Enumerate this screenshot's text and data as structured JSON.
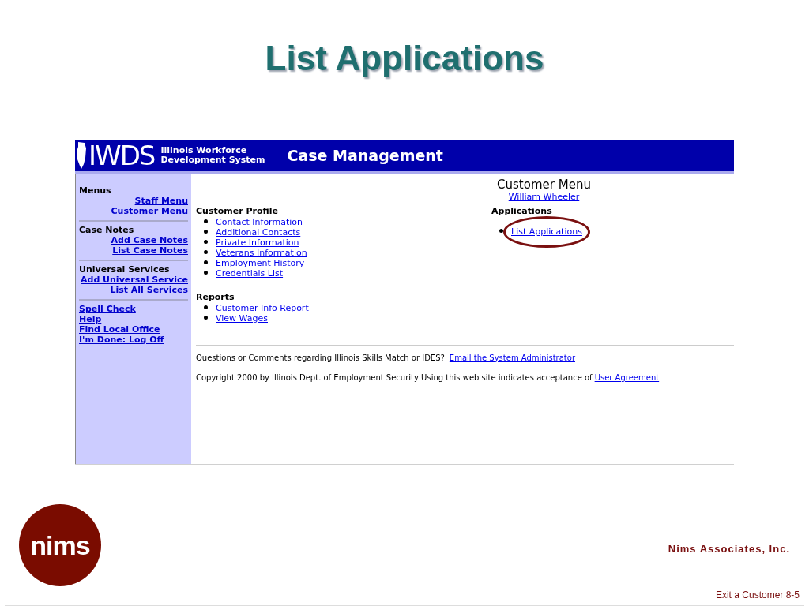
{
  "slide": {
    "title": "List Applications",
    "company": "Nims Associates, Inc.",
    "logo_text": "nims",
    "footer": "Exit a Customer 8-5"
  },
  "header": {
    "logo": "IWDS",
    "org_line1": "Illinois Workforce",
    "org_line2": "Development System",
    "title": "Case Management"
  },
  "sidebar": [
    {
      "kind": "right",
      "heading": "Menus",
      "links": [
        "Staff Menu",
        "Customer Menu"
      ]
    },
    {
      "kind": "right",
      "heading": "Case Notes",
      "links": [
        "Add Case Notes",
        "List Case Notes"
      ]
    },
    {
      "kind": "right",
      "heading": "Universal Services",
      "links": [
        "Add Universal Service",
        "List All Services"
      ]
    },
    {
      "kind": "left",
      "links": [
        "Spell Check",
        "Help",
        "Find Local Office",
        "I'm Done: Log Off"
      ]
    }
  ],
  "main": {
    "title": "Customer Menu",
    "customer": "William Wheeler",
    "customer_profile": {
      "heading": "Customer Profile",
      "items": [
        {
          "label": "Contact Information",
          "circled": false
        },
        {
          "label": "Additional Contacts",
          "circled": false
        },
        {
          "label": "Private Information",
          "circled": false
        },
        {
          "label": "Veterans Information",
          "circled": false
        },
        {
          "label": "Employment History",
          "circled": false
        },
        {
          "label": "Credentials List",
          "circled": false
        }
      ]
    },
    "applications": {
      "heading": "Applications",
      "items": [
        {
          "label": "List Applications",
          "circled": true
        }
      ]
    },
    "reports": {
      "heading": "Reports",
      "items": [
        {
          "label": "Customer Info Report",
          "circled": false
        },
        {
          "label": "View Wages",
          "circled": false
        }
      ]
    }
  },
  "footer": {
    "question": "Questions or Comments regarding Illinois Skills Match or IDES?",
    "question_link": "Email the System Administrator",
    "copyright": "Copyright 2000 by Illinois Dept. of Employment Security Using this web site indicates acceptance of",
    "copyright_link": "User Agreement"
  }
}
